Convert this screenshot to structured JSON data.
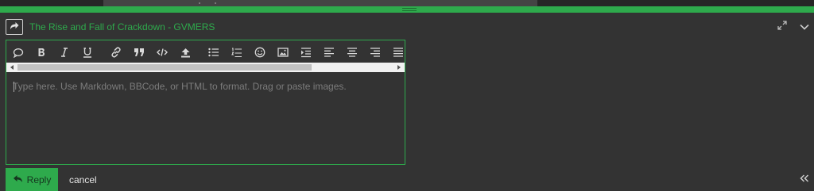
{
  "header": {
    "topic_title": "The Rise and Fall of Crackdown - GVMERS"
  },
  "editor": {
    "placeholder": "Type here. Use Markdown, BBCode, or HTML to format. Drag or paste images.",
    "value": "",
    "toolbar": [
      {
        "name": "quote",
        "icon": "speech-bubble-icon"
      },
      {
        "name": "bold",
        "icon": "bold-icon"
      },
      {
        "name": "italic",
        "icon": "italic-icon"
      },
      {
        "name": "underline",
        "icon": "underline-icon"
      },
      {
        "name": "link",
        "icon": "link-icon"
      },
      {
        "name": "blockquote",
        "icon": "quote-icon"
      },
      {
        "name": "code",
        "icon": "code-icon"
      },
      {
        "name": "upload",
        "icon": "upload-icon"
      },
      {
        "name": "bulleted-list",
        "icon": "bullet-list-icon"
      },
      {
        "name": "numbered-list",
        "icon": "numbered-list-icon"
      },
      {
        "name": "emoji",
        "icon": "smiley-icon"
      },
      {
        "name": "image",
        "icon": "image-icon"
      },
      {
        "name": "indent",
        "icon": "indent-icon"
      },
      {
        "name": "align-left",
        "icon": "align-left-icon"
      },
      {
        "name": "align-center",
        "icon": "align-center-icon"
      },
      {
        "name": "align-right",
        "icon": "align-right-icon"
      },
      {
        "name": "justify",
        "icon": "justify-icon"
      }
    ]
  },
  "footer": {
    "reply_label": "Reply",
    "cancel_label": "cancel"
  },
  "colors": {
    "accent": "#2eaa4c",
    "background": "#333333"
  }
}
